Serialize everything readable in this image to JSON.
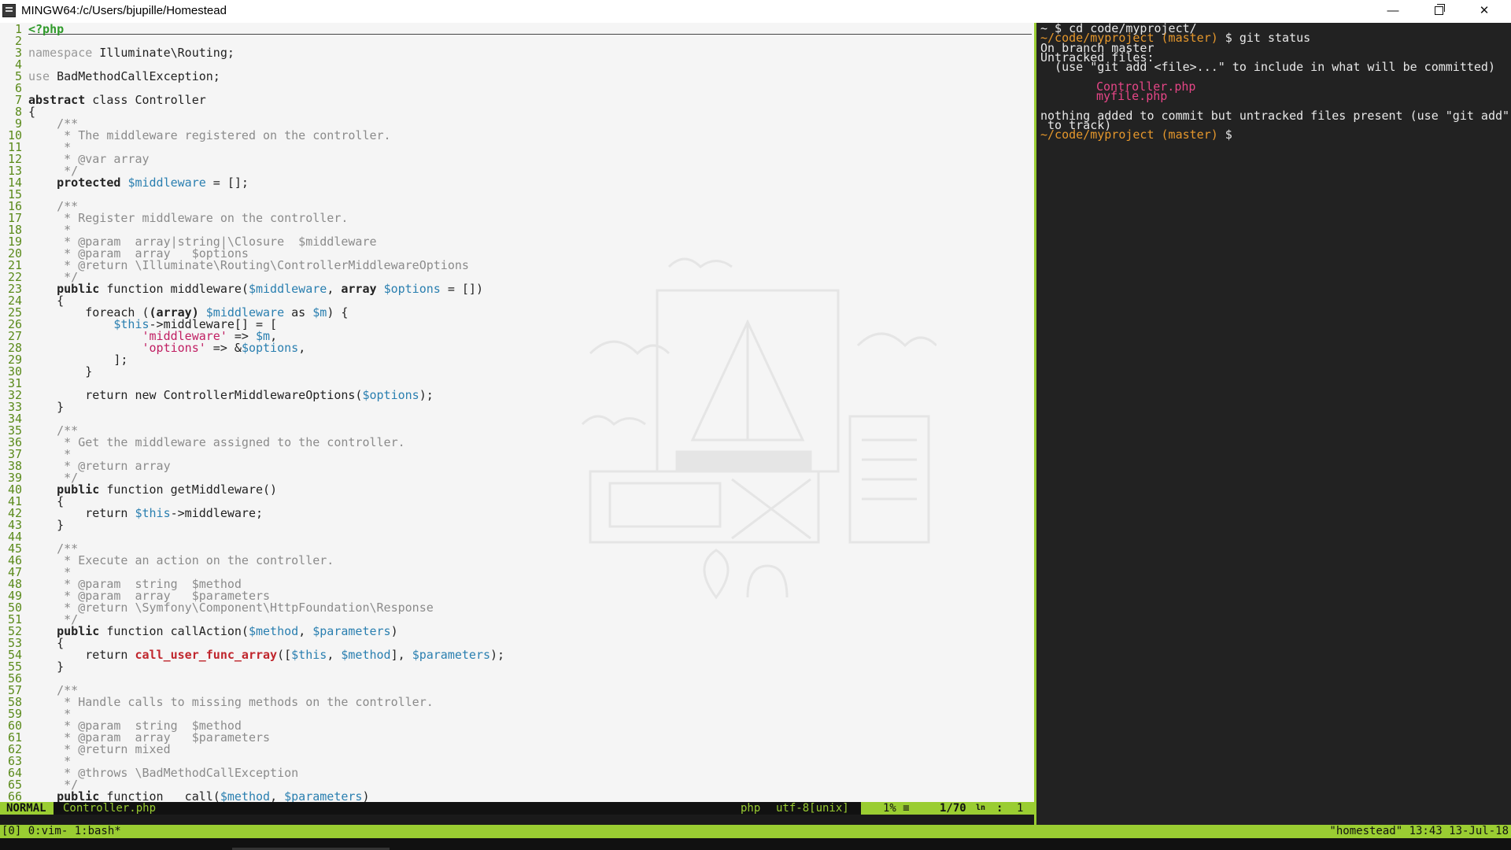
{
  "window": {
    "title": "MINGW64:/c/Users/bjupille/Homestead",
    "minimize_glyph": "—",
    "close_glyph": "✕",
    "icons": [
      "terminal-app-icon",
      "minimize-icon",
      "maximize-icon",
      "close-icon"
    ]
  },
  "editor": {
    "first_line_text": "<?php",
    "lines": [
      "1",
      "2",
      "3",
      "4",
      "5",
      "6",
      "7",
      "8",
      "9",
      "10",
      "11",
      "12",
      "13",
      "14",
      "15",
      "16",
      "17",
      "18",
      "19",
      "20",
      "21",
      "22",
      "23",
      "24",
      "25",
      "26",
      "27",
      "28",
      "29",
      "30",
      "31",
      "32",
      "33",
      "34",
      "35",
      "36",
      "37",
      "38",
      "39",
      "40",
      "41",
      "42",
      "43",
      "44",
      "45",
      "46",
      "47",
      "48",
      "49",
      "50",
      "51",
      "52",
      "53",
      "54",
      "55",
      "56",
      "57",
      "58",
      "59",
      "60",
      "61",
      "62",
      "63",
      "64",
      "65",
      "66"
    ],
    "code": {
      "l3": "namespace Illuminate\\Routing;",
      "l5": "use BadMethodCallException;",
      "l7": "abstract class Controller",
      "l8": "{",
      "l9": "    /**",
      "l10": "     * The middleware registered on the controller.",
      "l11": "     *",
      "l12": "     * @var array",
      "l13": "     */",
      "l14": "    protected $middleware = [];",
      "l16": "    /**",
      "l17": "     * Register middleware on the controller.",
      "l18": "     *",
      "l19": "     * @param  array|string|\\Closure  $middleware",
      "l20": "     * @param  array   $options",
      "l21": "     * @return \\Illuminate\\Routing\\ControllerMiddlewareOptions",
      "l22": "     */",
      "l23": "    public function middleware($middleware, array $options = [])",
      "l24": "    {",
      "l25": "        foreach ((array) $middleware as $m) {",
      "l26": "            $this->middleware[] = [",
      "l27": "                'middleware' => $m,",
      "l28": "                'options' => &$options,",
      "l29": "            ];",
      "l30": "        }",
      "l32": "        return new ControllerMiddlewareOptions($options);",
      "l33": "    }",
      "l35": "    /**",
      "l36": "     * Get the middleware assigned to the controller.",
      "l37": "     *",
      "l38": "     * @return array",
      "l39": "     */",
      "l40": "    public function getMiddleware()",
      "l41": "    {",
      "l42": "        return $this->middleware;",
      "l43": "    }",
      "l45": "    /**",
      "l46": "     * Execute an action on the controller.",
      "l47": "     *",
      "l48": "     * @param  string  $method",
      "l49": "     * @param  array   $parameters",
      "l50": "     * @return \\Symfony\\Component\\HttpFoundation\\Response",
      "l51": "     */",
      "l52": "    public function callAction($method, $parameters)",
      "l53": "    {",
      "l54": "        return call_user_func_array([$this, $method], $parameters);",
      "l55": "    }",
      "l57": "    /**",
      "l58": "     * Handle calls to missing methods on the controller.",
      "l59": "     *",
      "l60": "     * @param  string  $method",
      "l61": "     * @param  array   $parameters",
      "l62": "     * @return mixed",
      "l63": "     *",
      "l64": "     * @throws \\BadMethodCallException",
      "l65": "     */",
      "l66": "    public function __call($method, $parameters)"
    }
  },
  "statusline": {
    "mode": "NORMAL",
    "filename": "Controller.php",
    "filetype": "php",
    "encoding": "utf-8[unix]",
    "percent": "1% ≡",
    "position": "1/70",
    "ln_glyph": "ln",
    "col_sep": ":",
    "column": "1"
  },
  "terminal": {
    "lines": [
      {
        "prompt": "~ $ ",
        "cmd": "cd code/myproject/"
      },
      {
        "path": "~/code/myproject",
        "branch": " (master)",
        "prompt": " $ ",
        "cmd": "git status"
      },
      {
        "text": "On branch master"
      },
      {
        "text": "Untracked files:"
      },
      {
        "text": "  (use \"git add <file>...\" to include in what will be committed)"
      },
      {
        "text": ""
      },
      {
        "file": "Controller.php"
      },
      {
        "file": "myfile.php"
      },
      {
        "text": ""
      },
      {
        "text": "nothing added to commit but untracked files present (use \"git add\""
      },
      {
        "text": " to track)"
      },
      {
        "path": "~/code/myproject",
        "branch": " (master)",
        "prompt": " $ ",
        "cmd": ""
      }
    ]
  },
  "tmux": {
    "left": "[0] 0:vim- 1:bash*",
    "right": "\"homestead\" 13:43 13-Jul-18"
  }
}
